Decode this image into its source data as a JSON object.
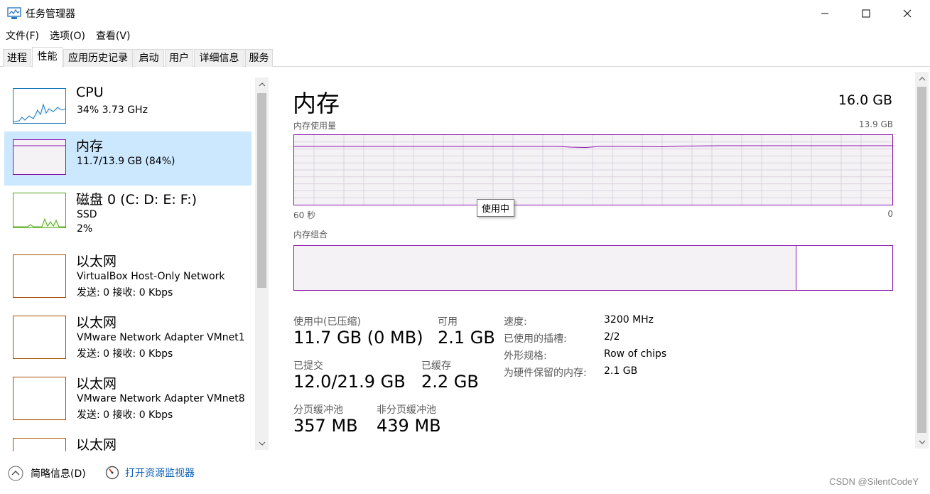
{
  "window": {
    "title": "任务管理器"
  },
  "menu": {
    "file": "文件(F)",
    "options": "选项(O)",
    "view": "查看(V)"
  },
  "tabs": {
    "processes": "进程",
    "performance": "性能",
    "app_history": "应用历史记录",
    "startup": "启动",
    "users": "用户",
    "details": "详细信息",
    "services": "服务"
  },
  "sidebar": {
    "items": [
      {
        "title": "CPU",
        "line1": "34%  3.73 GHz",
        "line2": "",
        "color": "#1779ba"
      },
      {
        "title": "内存",
        "line1": "11.7/13.9 GB (84%)",
        "line2": "",
        "color": "#8b12ae"
      },
      {
        "title": "磁盘 0 (C: D: E: F:)",
        "line1": "SSD",
        "line2": "2%",
        "color": "#4da60c"
      },
      {
        "title": "以太网",
        "line1": "VirtualBox Host-Only Network",
        "line2": "发送: 0  接收: 0 Kbps",
        "color": "#a74f01"
      },
      {
        "title": "以太网",
        "line1": "VMware Network Adapter VMnet1",
        "line2": "发送: 0  接收: 0 Kbps",
        "color": "#a74f01"
      },
      {
        "title": "以太网",
        "line1": "VMware Network Adapter VMnet8",
        "line2": "发送: 0  接收: 0 Kbps",
        "color": "#a74f01"
      },
      {
        "title": "以太网",
        "line1": "",
        "line2": "",
        "color": "#a74f01"
      }
    ]
  },
  "memory": {
    "title": "内存",
    "total": "16.0 GB",
    "usage_label": "内存使用量",
    "usage_max": "13.9 GB",
    "time_left": "60 秒",
    "time_right": "0",
    "tooltip": "使用中",
    "composition_label": "内存组合",
    "in_use_fraction": 0.84,
    "stats": {
      "in_use_label": "使用中(已压缩)",
      "in_use_value": "11.7 GB (0 MB)",
      "available_label": "可用",
      "available_value": "2.1 GB",
      "committed_label": "已提交",
      "committed_value": "12.0/21.9 GB",
      "cached_label": "已缓存",
      "cached_value": "2.2 GB",
      "paged_label": "分页缓冲池",
      "paged_value": "357 MB",
      "nonpaged_label": "非分页缓冲池",
      "nonpaged_value": "439 MB"
    },
    "details": {
      "speed_label": "速度:",
      "speed_value": "3200 MHz",
      "slots_label": "已使用的插槽:",
      "slots_value": "2/2",
      "form_label": "外形规格:",
      "form_value": "Row of chips",
      "reserved_label": "为硬件保留的内存:",
      "reserved_value": "2.1 GB"
    }
  },
  "footer": {
    "brief_info": "简略信息(D)",
    "open_monitor": "打开资源监视器"
  },
  "watermark": "CSDN @SilentCodeY"
}
